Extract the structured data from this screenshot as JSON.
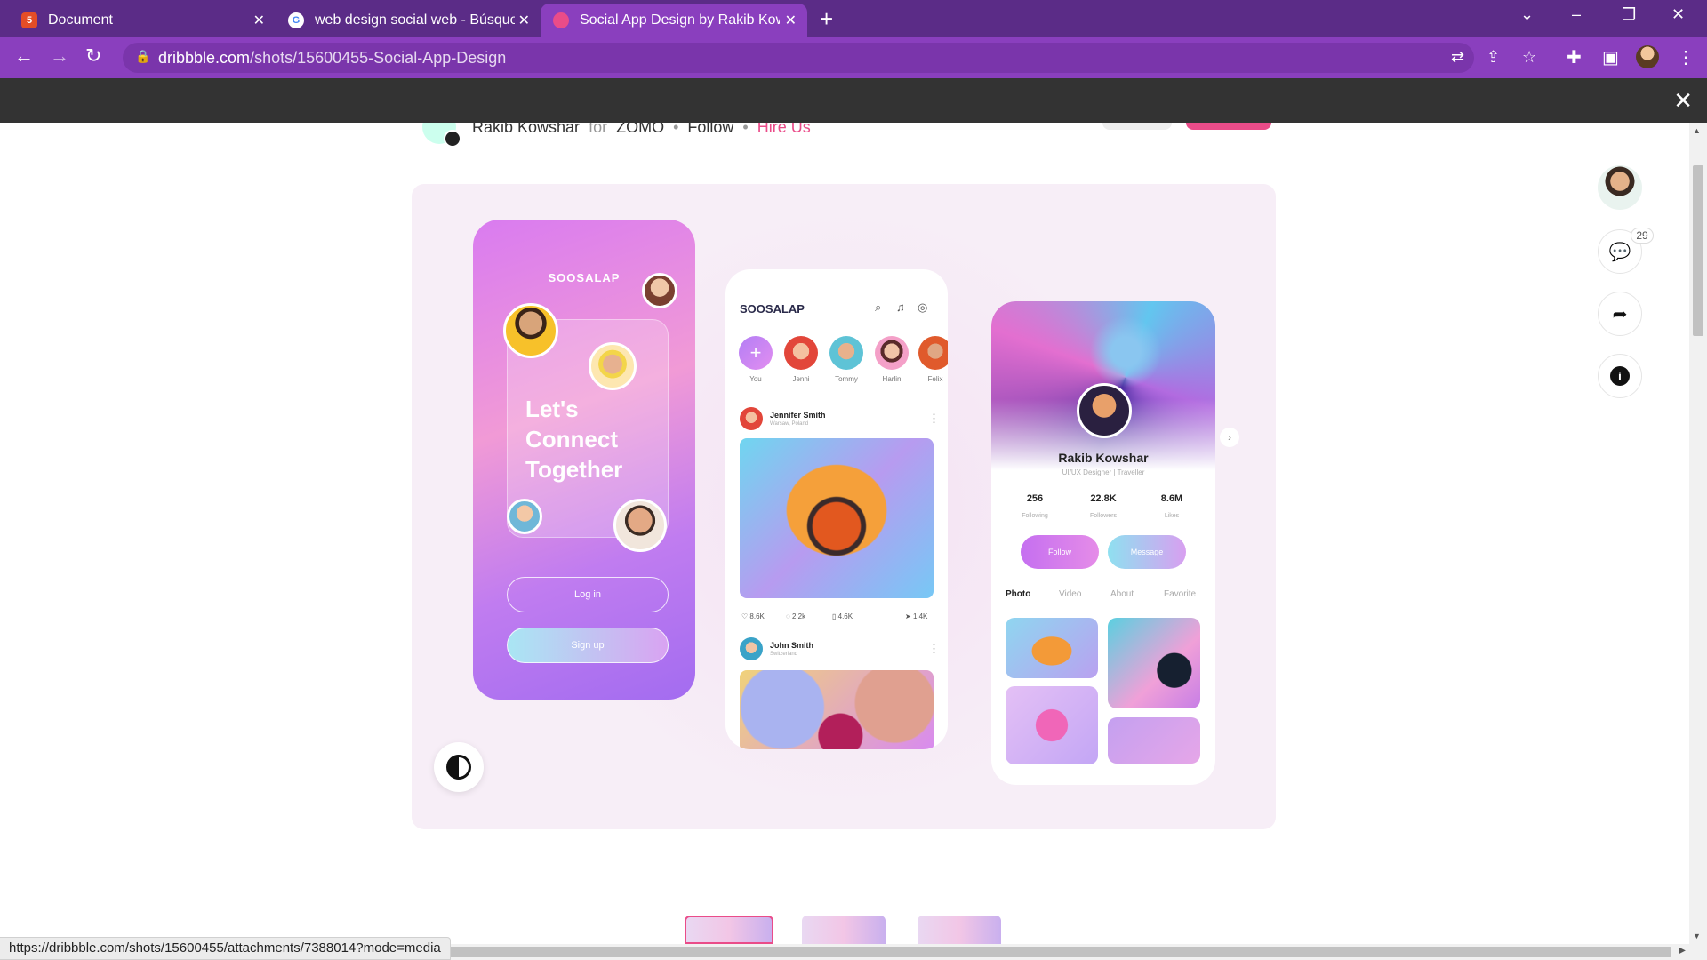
{
  "browser": {
    "tabs": [
      {
        "title": "Document",
        "active": false
      },
      {
        "title": "web design social web - Búsqueda",
        "active": false
      },
      {
        "title": "Social App Design by Rakib Kowshar",
        "active": true
      }
    ],
    "url_host": "dribbble.com",
    "url_path": "/shots/15600455-Social-App-Design",
    "status_url": "https://dribbble.com/shots/15600455/attachments/7388014?mode=media"
  },
  "shot": {
    "author": "Rakib Kowshar",
    "for_word": "for",
    "team": "ZOMO",
    "follow": "Follow",
    "hire": "Hire Us",
    "comment_count": "29"
  },
  "phone1": {
    "brand": "SOOSALAP",
    "hero_line1": "Let's",
    "hero_line2": "Connect",
    "hero_line3": "Together",
    "login": "Log in",
    "signup": "Sign up"
  },
  "phone2": {
    "brand": "SOOSALAP",
    "stories": [
      "You",
      "Jenni",
      "Tommy",
      "Harlin",
      "Felix"
    ],
    "post1": {
      "name": "Jennifer Smith",
      "location": "Warsaw, Poland"
    },
    "post1_stats": {
      "likes": "8.6K",
      "comments": "2.2k",
      "saves": "4.6K",
      "shares": "1.4K"
    },
    "post2": {
      "name": "John Smith",
      "location": "Switzerland"
    }
  },
  "phone3": {
    "name": "Rakib Kowshar",
    "role": "UI/UX Designer | Traveller",
    "kpis": [
      {
        "value": "256",
        "label": "Following"
      },
      {
        "value": "22.8K",
        "label": "Followers"
      },
      {
        "value": "8.6M",
        "label": "Likes"
      }
    ],
    "follow": "Follow",
    "message": "Message",
    "tabs": [
      "Photo",
      "Video",
      "About",
      "Favorite"
    ]
  },
  "colors": {
    "browser_frame": "#5b2c87",
    "toolbar": "#8a3fbe",
    "dribbble_pink": "#ea4c89"
  }
}
